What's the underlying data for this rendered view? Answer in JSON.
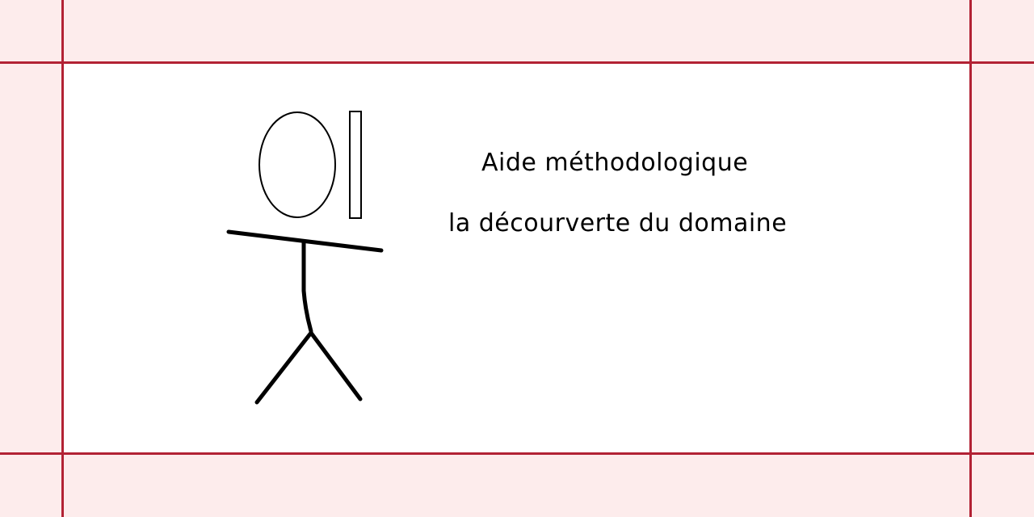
{
  "slide": {
    "title": "Aide méthodologique",
    "subtitle": "la décourverte du domaine"
  },
  "colors": {
    "frame_line": "#b22234",
    "margin_fill": "#fdecec",
    "panel_fill": "#ffffff",
    "ink": "#000000"
  },
  "illustration": {
    "icon": "stick-figure-with-mirror-icon"
  }
}
